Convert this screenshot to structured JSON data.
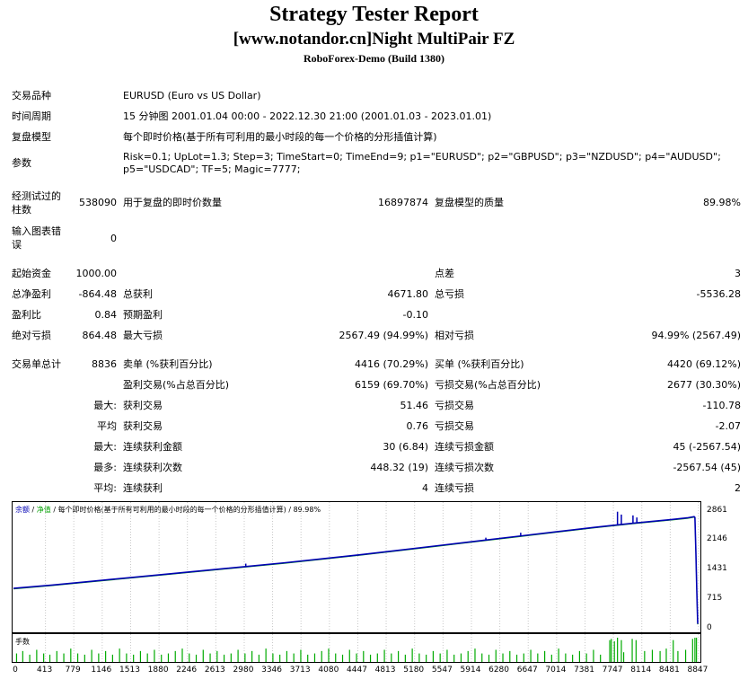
{
  "header": {
    "title": "Strategy Tester Report",
    "subtitle": "[www.notandor.cn]Night MultiPair FZ",
    "server": "RoboForex-Demo (Build 1380)"
  },
  "info": {
    "symbol_label": "交易品种",
    "symbol_value": "EURUSD (Euro vs US Dollar)",
    "period_label": "时间周期",
    "period_value": "15 分钟图 2001.01.04 00:00 - 2022.12.30 21:00 (2001.01.03 - 2023.01.01)",
    "model_label": "复盘模型",
    "model_value": "每个即时价格(基于所有可利用的最小时段的每一个价格的分形插值计算)",
    "params_label": "参数",
    "params_line1": "Risk=0.1; UpLot=1.3; Step=3; TimeStart=0; TimeEnd=9; p1=\"EURUSD\"; p2=\"GBPUSD\"; p3=\"NZDUSD\"; p4=\"AUDUSD\";",
    "params_line2": "p5=\"USDCAD\"; TF=5; Magic=7777;"
  },
  "stats": {
    "bars_label_1": "经测试过的",
    "bars_label_2": "柱数",
    "bars_value": "538090",
    "ticks_label": "用于复盘的即时价数量",
    "ticks_value": "16897874",
    "quality_label": "复盘模型的质量",
    "quality_value": "89.98%",
    "errors_label_1": "输入图表错",
    "errors_label_2": "误",
    "errors_value": "0",
    "deposit_label": "起始资金",
    "deposit_value": "1000.00",
    "spread_label": "点差",
    "spread_value": "3",
    "netprofit_label": "总净盈利",
    "netprofit_value": "-864.48",
    "grossprofit_label": "总获利",
    "grossprofit_value": "4671.80",
    "grossloss_label": "总亏损",
    "grossloss_value": "-5536.28",
    "pf_label": "盈利比",
    "pf_value": "0.84",
    "expected_label": "预期盈利",
    "expected_value": "-0.10",
    "absdd_label": "绝对亏损",
    "absdd_value": "864.48",
    "maxdd_label": "最大亏损",
    "maxdd_value": "2567.49 (94.99%)",
    "reldd_label": "相对亏损",
    "reldd_value": "94.99% (2567.49)",
    "trades_label": "交易单总计",
    "trades_value": "8836",
    "short_label": "卖单 (%获利百分比)",
    "short_value": "4416 (70.29%)",
    "long_label": "买单 (%获利百分比)",
    "long_value": "4420 (69.12%)",
    "profit_trades_label": "盈利交易(%占总百分比)",
    "profit_trades_value": "6159 (69.70%)",
    "loss_trades_label": "亏损交易(%占总百分比)",
    "loss_trades_value": "2677 (30.30%)",
    "largest_prefix": "最大:",
    "largest_profit_label": "获利交易",
    "largest_profit_value": "51.46",
    "largest_loss_label": "亏损交易",
    "largest_loss_value": "-110.78",
    "average_prefix": "平均",
    "avg_profit_label": "获利交易",
    "avg_profit_value": "0.76",
    "avg_loss_label": "亏损交易",
    "avg_loss_value": "-2.07",
    "max_prefix": "最大:",
    "max_consec_wins_label": "连续获利金额",
    "max_consec_wins_value": "30 (6.84)",
    "max_consec_losses_label": "连续亏损金额",
    "max_consec_losses_value": "45 (-2567.54)",
    "most_prefix": "最多:",
    "most_consec_profit_label": "连续获利次数",
    "most_consec_profit_value": "448.32 (19)",
    "most_consec_loss_label": "连续亏损次数",
    "most_consec_loss_value": "-2567.54 (45)",
    "avg2_prefix": "平均:",
    "avg_consec_wins_label": "连续获利",
    "avg_consec_wins_value": "4",
    "avg_consec_losses_label": "连续亏损",
    "avg_consec_losses_value": "2"
  },
  "chart_data": {
    "type": "line",
    "title_balance": "余额",
    "title_sep1": " / ",
    "title_equity": "净值",
    "title_rest": " / 每个即时价格(基于所有可利用的最小时段的每一个价格的分形插值计算) / 89.98%",
    "volume_label": "手数",
    "yticks": [
      "2861",
      "2146",
      "1431",
      "715",
      "0"
    ],
    "ytick_values": [
      2861,
      2146,
      1431,
      715,
      0
    ],
    "xticks": [
      "0",
      "413",
      "779",
      "1146",
      "1513",
      "1880",
      "2246",
      "2613",
      "2980",
      "3346",
      "3713",
      "4080",
      "4447",
      "4813",
      "5180",
      "5547",
      "5914",
      "6280",
      "6647",
      "7014",
      "7381",
      "7747",
      "8114",
      "8481",
      "8847"
    ],
    "xtick_values": [
      0,
      413,
      779,
      1146,
      1513,
      1880,
      2246,
      2613,
      2980,
      3346,
      3713,
      4080,
      4447,
      4813,
      5180,
      5547,
      5914,
      6280,
      6647,
      7014,
      7381,
      7747,
      8114,
      8481,
      8847
    ],
    "xlim": [
      0,
      8836
    ],
    "ylim": [
      0,
      3050
    ],
    "balance": {
      "x": [
        0,
        500,
        1000,
        1500,
        2000,
        2500,
        3000,
        3500,
        4000,
        4500,
        5000,
        5500,
        6000,
        6500,
        7000,
        7500,
        8000,
        8500,
        8700,
        8790,
        8800,
        8812,
        8824,
        8836
      ],
      "y": [
        1000,
        1080,
        1170,
        1260,
        1350,
        1440,
        1530,
        1620,
        1720,
        1820,
        1930,
        2040,
        2150,
        2260,
        2370,
        2480,
        2580,
        2670,
        2710,
        2740,
        2720,
        1900,
        950,
        140
      ]
    },
    "equity_spikes": [
      {
        "x": 3000,
        "y": 1600
      },
      {
        "x": 6100,
        "y": 2230
      },
      {
        "x": 6550,
        "y": 2350
      },
      {
        "x": 7800,
        "y": 2860
      },
      {
        "x": 7850,
        "y": 2790
      },
      {
        "x": 8000,
        "y": 2770
      },
      {
        "x": 8050,
        "y": 2720
      }
    ],
    "volume_bars": [
      {
        "x": 40,
        "h": 0.35
      },
      {
        "x": 120,
        "h": 0.45
      },
      {
        "x": 210,
        "h": 0.3
      },
      {
        "x": 300,
        "h": 0.5
      },
      {
        "x": 390,
        "h": 0.35
      },
      {
        "x": 470,
        "h": 0.3
      },
      {
        "x": 560,
        "h": 0.45
      },
      {
        "x": 650,
        "h": 0.35
      },
      {
        "x": 740,
        "h": 0.55
      },
      {
        "x": 830,
        "h": 0.35
      },
      {
        "x": 920,
        "h": 0.3
      },
      {
        "x": 1010,
        "h": 0.5
      },
      {
        "x": 1100,
        "h": 0.35
      },
      {
        "x": 1190,
        "h": 0.45
      },
      {
        "x": 1280,
        "h": 0.3
      },
      {
        "x": 1370,
        "h": 0.55
      },
      {
        "x": 1460,
        "h": 0.35
      },
      {
        "x": 1550,
        "h": 0.3
      },
      {
        "x": 1640,
        "h": 0.45
      },
      {
        "x": 1730,
        "h": 0.35
      },
      {
        "x": 1820,
        "h": 0.5
      },
      {
        "x": 1910,
        "h": 0.3
      },
      {
        "x": 2000,
        "h": 0.35
      },
      {
        "x": 2090,
        "h": 0.45
      },
      {
        "x": 2180,
        "h": 0.55
      },
      {
        "x": 2270,
        "h": 0.35
      },
      {
        "x": 2360,
        "h": 0.3
      },
      {
        "x": 2450,
        "h": 0.5
      },
      {
        "x": 2540,
        "h": 0.35
      },
      {
        "x": 2630,
        "h": 0.45
      },
      {
        "x": 2720,
        "h": 0.3
      },
      {
        "x": 2810,
        "h": 0.35
      },
      {
        "x": 2900,
        "h": 0.5
      },
      {
        "x": 2990,
        "h": 0.35
      },
      {
        "x": 3080,
        "h": 0.45
      },
      {
        "x": 3170,
        "h": 0.3
      },
      {
        "x": 3260,
        "h": 0.55
      },
      {
        "x": 3350,
        "h": 0.35
      },
      {
        "x": 3440,
        "h": 0.3
      },
      {
        "x": 3530,
        "h": 0.45
      },
      {
        "x": 3620,
        "h": 0.35
      },
      {
        "x": 3710,
        "h": 0.5
      },
      {
        "x": 3800,
        "h": 0.3
      },
      {
        "x": 3890,
        "h": 0.35
      },
      {
        "x": 3980,
        "h": 0.45
      },
      {
        "x": 4070,
        "h": 0.55
      },
      {
        "x": 4160,
        "h": 0.35
      },
      {
        "x": 4250,
        "h": 0.3
      },
      {
        "x": 4340,
        "h": 0.5
      },
      {
        "x": 4430,
        "h": 0.35
      },
      {
        "x": 4520,
        "h": 0.45
      },
      {
        "x": 4610,
        "h": 0.3
      },
      {
        "x": 4700,
        "h": 0.35
      },
      {
        "x": 4790,
        "h": 0.5
      },
      {
        "x": 4880,
        "h": 0.35
      },
      {
        "x": 4970,
        "h": 0.45
      },
      {
        "x": 5060,
        "h": 0.3
      },
      {
        "x": 5150,
        "h": 0.55
      },
      {
        "x": 5240,
        "h": 0.35
      },
      {
        "x": 5330,
        "h": 0.3
      },
      {
        "x": 5420,
        "h": 0.45
      },
      {
        "x": 5510,
        "h": 0.35
      },
      {
        "x": 5600,
        "h": 0.5
      },
      {
        "x": 5690,
        "h": 0.3
      },
      {
        "x": 5780,
        "h": 0.35
      },
      {
        "x": 5870,
        "h": 0.45
      },
      {
        "x": 5960,
        "h": 0.55
      },
      {
        "x": 6050,
        "h": 0.35
      },
      {
        "x": 6140,
        "h": 0.3
      },
      {
        "x": 6230,
        "h": 0.5
      },
      {
        "x": 6320,
        "h": 0.35
      },
      {
        "x": 6410,
        "h": 0.45
      },
      {
        "x": 6500,
        "h": 0.3
      },
      {
        "x": 6590,
        "h": 0.35
      },
      {
        "x": 6680,
        "h": 0.5
      },
      {
        "x": 6770,
        "h": 0.35
      },
      {
        "x": 6860,
        "h": 0.45
      },
      {
        "x": 6950,
        "h": 0.3
      },
      {
        "x": 7040,
        "h": 0.55
      },
      {
        "x": 7130,
        "h": 0.35
      },
      {
        "x": 7220,
        "h": 0.3
      },
      {
        "x": 7310,
        "h": 0.45
      },
      {
        "x": 7400,
        "h": 0.35
      },
      {
        "x": 7490,
        "h": 0.5
      },
      {
        "x": 7580,
        "h": 0.3
      },
      {
        "x": 7700,
        "h": 0.9
      },
      {
        "x": 7720,
        "h": 0.95
      },
      {
        "x": 7760,
        "h": 0.85
      },
      {
        "x": 7800,
        "h": 1.0
      },
      {
        "x": 7850,
        "h": 0.9
      },
      {
        "x": 7880,
        "h": 0.4
      },
      {
        "x": 7990,
        "h": 0.95
      },
      {
        "x": 8040,
        "h": 0.9
      },
      {
        "x": 8150,
        "h": 0.45
      },
      {
        "x": 8250,
        "h": 0.5
      },
      {
        "x": 8350,
        "h": 0.45
      },
      {
        "x": 8430,
        "h": 0.55
      },
      {
        "x": 8520,
        "h": 0.9
      },
      {
        "x": 8580,
        "h": 0.45
      },
      {
        "x": 8680,
        "h": 0.5
      },
      {
        "x": 8770,
        "h": 0.95
      },
      {
        "x": 8800,
        "h": 1.0
      },
      {
        "x": 8820,
        "h": 1.0
      }
    ],
    "colors": {
      "balance": "#0000b4",
      "equity": "#00a000",
      "volume": "#00aa00",
      "title_balance": "#0000b4",
      "title_equity": "#00a000"
    }
  }
}
